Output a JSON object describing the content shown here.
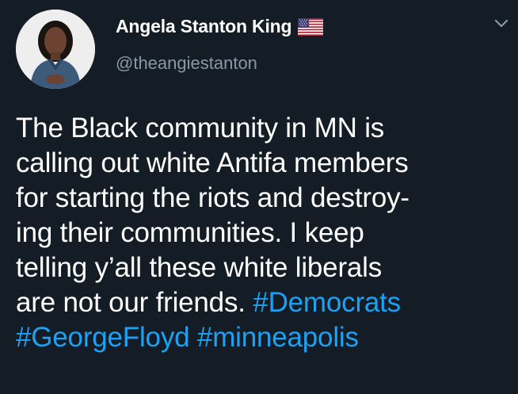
{
  "author": {
    "display_name": "Angela Stanton King",
    "flag_icon": "us-flag-icon",
    "handle": "@theangiestanton",
    "avatar_icon": "profile-photo"
  },
  "menu": {
    "icon": "chevron-down-icon"
  },
  "tweet": {
    "lines": [
      {
        "text": "The Black community in MN is"
      },
      {
        "text": "calling out white Antifa members"
      },
      {
        "text": "for starting the riots and destroy-"
      },
      {
        "text": "ing their communities. I keep"
      },
      {
        "text": "telling y’all these white liberals"
      },
      {
        "text": "are not our friends. ",
        "hashtag": "#Democrats"
      },
      {
        "hashtag": "#GeorgeFloyd",
        "text_between": " ",
        "hashtag2": "#minneapolis"
      }
    ]
  },
  "colors": {
    "background": "#141d26",
    "text": "#ffffff",
    "secondary_text": "#8899a6",
    "hashtag": "#1da1f2"
  }
}
